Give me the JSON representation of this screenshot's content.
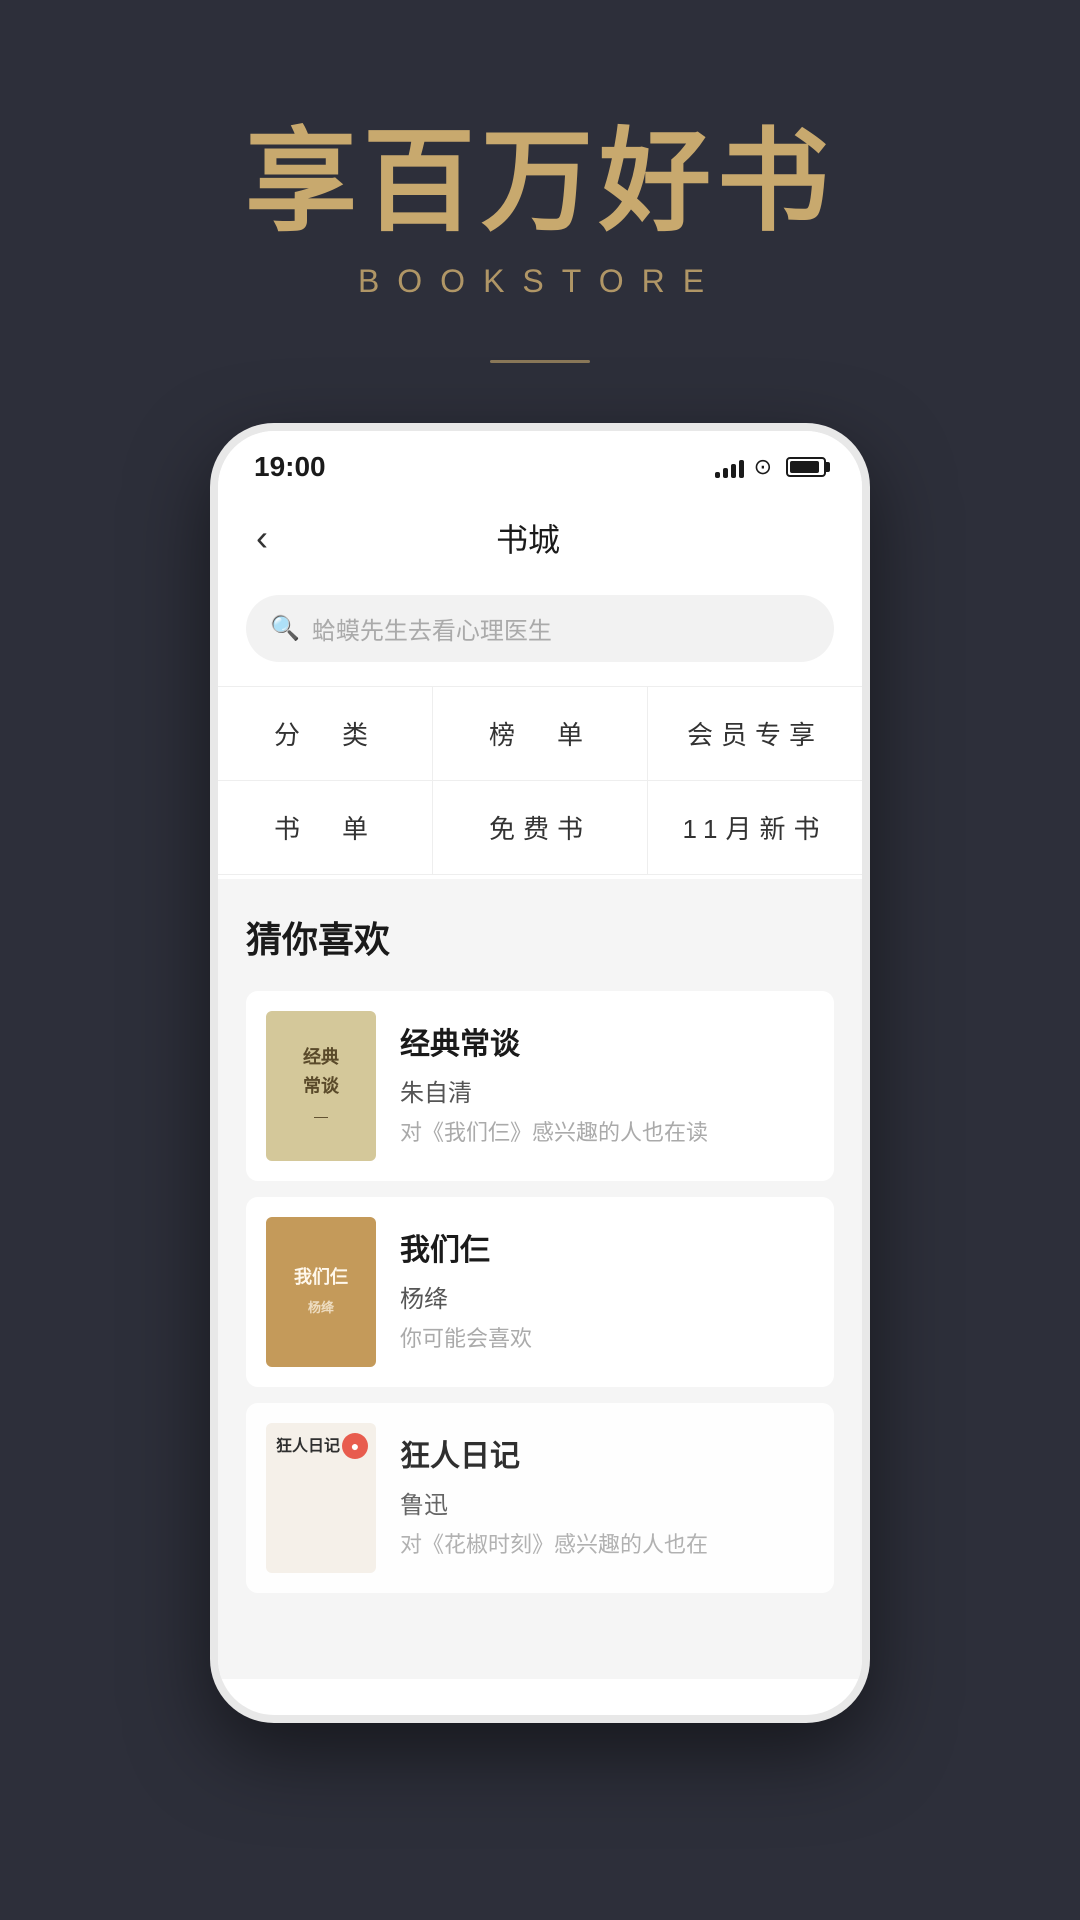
{
  "hero": {
    "title": "享百万好书",
    "subtitle": "BOOKSTORE",
    "divider": true
  },
  "status_bar": {
    "time": "19:00",
    "signal_bars": [
      6,
      10,
      14,
      18,
      22
    ],
    "wifi": "wifi",
    "battery": "battery"
  },
  "nav": {
    "back_label": "‹",
    "title": "书城"
  },
  "search": {
    "placeholder": "蛤蟆先生去看心理医生"
  },
  "categories": [
    {
      "label": "分　类"
    },
    {
      "label": "榜　单"
    },
    {
      "label": "会员专享"
    },
    {
      "label": "书　单"
    },
    {
      "label": "免费书"
    },
    {
      "label": "11月新书"
    }
  ],
  "recommendations_title": "猜你喜欢",
  "books": [
    {
      "title": "经典常谈",
      "author": "朱自清",
      "desc": "对《我们仨》感兴趣的人也在读",
      "cover_type": "jingdian",
      "cover_text": "经典\n常谈"
    },
    {
      "title": "我们仨",
      "author": "杨绛",
      "desc": "你可能会喜欢",
      "cover_type": "women",
      "cover_text": "我们仨"
    },
    {
      "title": "狂人日记",
      "author": "鲁迅",
      "desc": "对《花椒时刻》感兴趣的人也在",
      "cover_type": "kuangren",
      "cover_text": "狂人日记"
    }
  ]
}
